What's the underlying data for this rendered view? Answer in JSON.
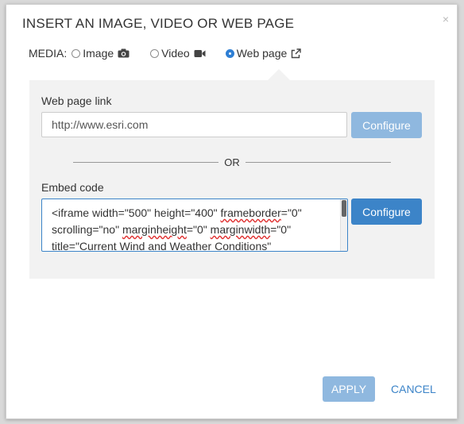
{
  "dialog": {
    "title": "INSERT AN IMAGE, VIDEO OR WEB PAGE",
    "close": "×"
  },
  "media": {
    "label": "MEDIA:",
    "options": [
      {
        "label": "Image",
        "icon": "camera-icon",
        "checked": false
      },
      {
        "label": "Video",
        "icon": "video-camera-icon",
        "checked": false
      },
      {
        "label": "Web page",
        "icon": "external-link-icon",
        "checked": true
      }
    ]
  },
  "web_page_link": {
    "label": "Web page link",
    "value": "http://www.esri.com",
    "configure_label": "Configure"
  },
  "separator": {
    "text": "OR"
  },
  "embed": {
    "label": "Embed code",
    "lines": [
      "<iframe width=\"500\" height=\"400\" frameborder=\"0\"",
      "scrolling=\"no\" marginheight=\"0\" marginwidth=\"0\"",
      "title=\"Current Wind and Weather Conditions\""
    ],
    "configure_label": "Configure"
  },
  "footer": {
    "apply_label": "APPLY",
    "cancel_label": "CANCEL"
  },
  "colors": {
    "accent": "#3c84c8",
    "disabled_button": "#8fb8df",
    "panel": "#f2f2f2"
  }
}
